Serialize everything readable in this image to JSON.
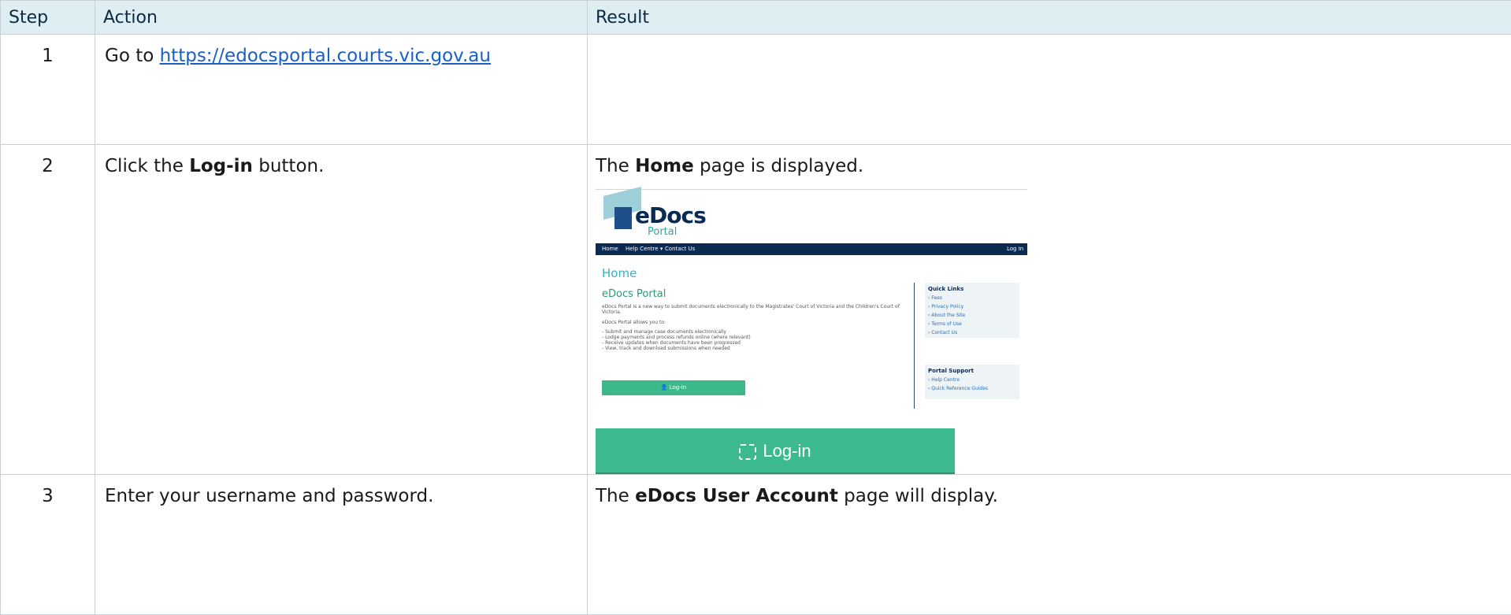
{
  "columns": {
    "step": "Step",
    "action": "Action",
    "result": "Result"
  },
  "rows": [
    {
      "step": "1",
      "action_prefix": "Go to ",
      "action_link": "https://edocsportal.courts.vic.gov.au",
      "result": ""
    },
    {
      "step": "2",
      "action_prefix": "Click the ",
      "action_bold": "Log-in",
      "action_suffix": " button.",
      "result_prefix": "The ",
      "result_bold": "Home",
      "result_suffix": " page is displayed."
    },
    {
      "step": "3",
      "action": "Enter your username and password.",
      "result_prefix": "The ",
      "result_bold": "eDocs User Account",
      "result_suffix": " page will display."
    }
  ],
  "screenshot": {
    "logo_word": "eDocs",
    "logo_sub": "Portal",
    "nav": {
      "home": "Home",
      "help": "Help Centre ▾",
      "contact": "Contact Us",
      "login": "Log In"
    },
    "page_heading": "Home",
    "section_heading": "eDocs Portal",
    "intro": "eDocs Portal is a new way to submit documents electronically to the Magistrates' Court of Victoria and the Children's Court of Victoria.",
    "allows": "eDocs Portal allows you to:",
    "bullets": [
      "- Submit and manage case documents electronically",
      "- Lodge payments and process refunds online (where relevant)",
      "- Receive updates when documents have been progressed",
      "- View, track and download submissions when needed"
    ],
    "login_small": "👤 Log-In",
    "quick_links_title": "Quick Links",
    "quick_links": [
      "› Fees",
      "› Privacy Policy",
      "› About the Site",
      "› Terms of Use",
      "› Contact Us"
    ],
    "support_title": "Portal Support",
    "support_links": [
      "› Help Centre",
      "› Quick Reference Guides"
    ]
  },
  "login_button_label": "Log-in"
}
